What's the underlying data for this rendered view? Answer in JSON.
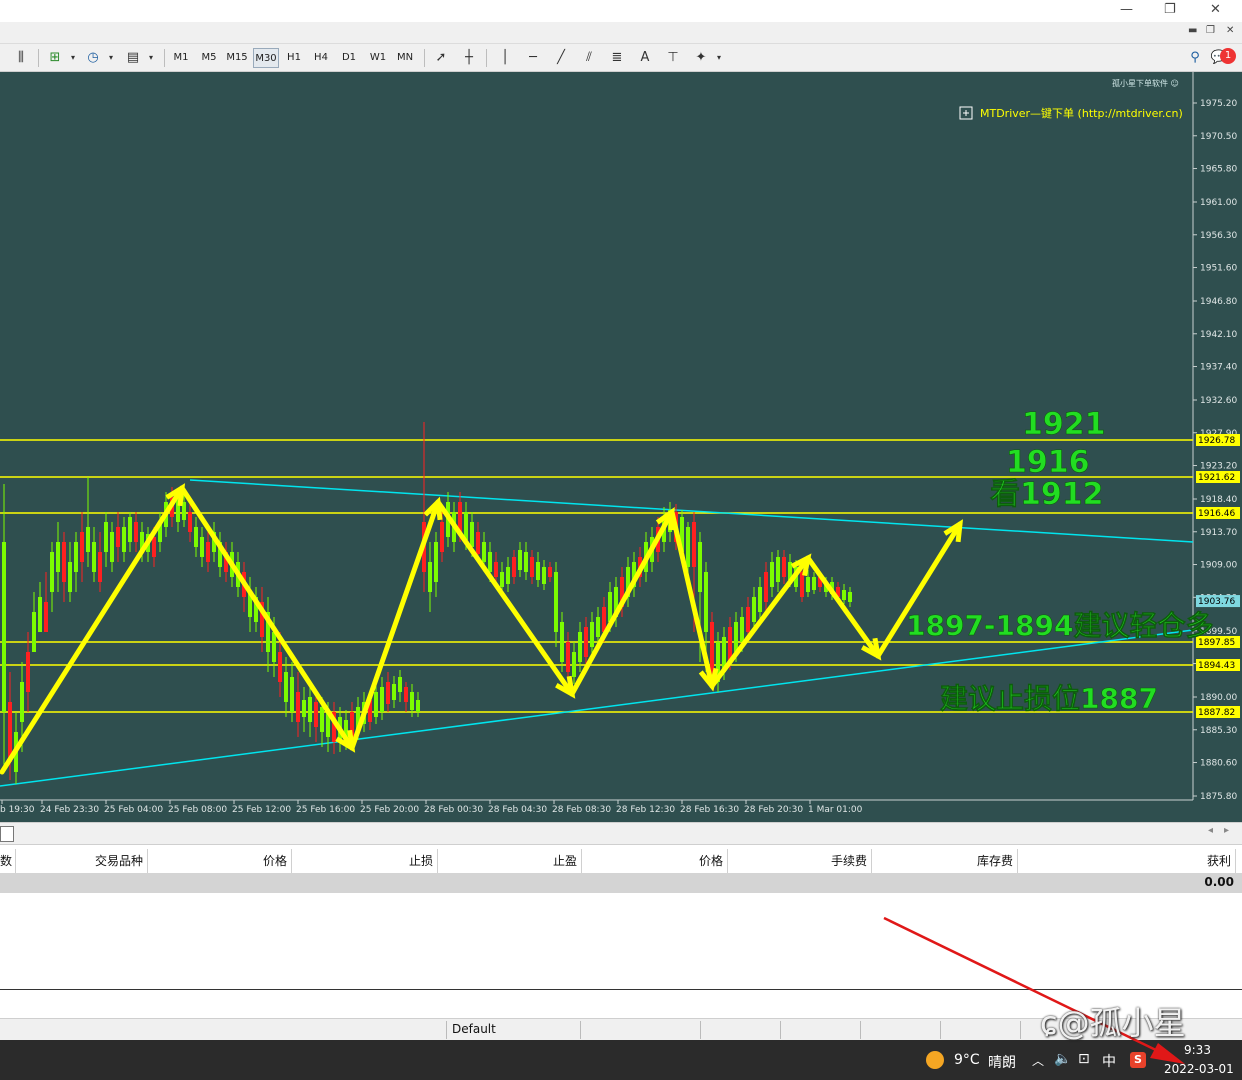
{
  "window": {
    "controls": [
      "—",
      "❐",
      "✕"
    ],
    "mdi_controls": [
      "▬",
      "❐",
      "✕"
    ]
  },
  "toolbar": {
    "timeframes": [
      "M1",
      "M5",
      "M15",
      "M30",
      "H1",
      "H4",
      "D1",
      "W1",
      "MN"
    ],
    "active_timeframe": "M30",
    "notifications_badge": "1"
  },
  "chart": {
    "corner_label": "孤小星下单软件 ☺",
    "plugin_label": "MTDriver—键下单 (http://mtdriver.cn)",
    "price_labels": [
      "1975.20",
      "1970.50",
      "1965.80",
      "1961.00",
      "1956.30",
      "1951.60",
      "1946.80",
      "1942.10",
      "1937.40",
      "1932.60",
      "1927.90",
      "1923.20",
      "1918.40",
      "1913.70",
      "1909.00",
      "1904.30",
      "1899.50",
      "1894.80",
      "1890.00",
      "1885.30",
      "1880.60",
      "1875.80"
    ],
    "level_tags": [
      {
        "price": "1926.78",
        "color": "#ffff00"
      },
      {
        "price": "1921.62",
        "color": "#ffff00"
      },
      {
        "price": "1916.46",
        "color": "#ffff00"
      },
      {
        "price": "1903.76",
        "color": "#7fd8e0"
      },
      {
        "price": "1897.85",
        "color": "#ffff00"
      },
      {
        "price": "1894.43",
        "color": "#ffff00"
      },
      {
        "price": "1887.82",
        "color": "#ffff00"
      }
    ],
    "time_labels": [
      "b 19:30",
      "24 Feb 23:30",
      "25 Feb 04:00",
      "25 Feb 08:00",
      "25 Feb 12:00",
      "25 Feb 16:00",
      "25 Feb 20:00",
      "28 Feb 00:30",
      "28 Feb 04:30",
      "28 Feb 08:30",
      "28 Feb 12:30",
      "28 Feb 16:30",
      "28 Feb 20:30",
      "1 Mar 01:00"
    ],
    "annotations": {
      "a1921": "1921",
      "a1916": "1916",
      "a1912": "看1912",
      "buy_zone": "1897-1894建议轻仓多",
      "stop_loss": "建议止损位1887"
    },
    "colors": {
      "background": "#2f4f4f",
      "levels": "#ffff00",
      "trendline": "#00e5ee",
      "bull": "#7cfc00",
      "bear": "#ff2020",
      "annotation": "#22dd22"
    }
  },
  "terminal": {
    "columns": [
      "数",
      "交易品种",
      "价格",
      "止损",
      "止盈",
      "价格",
      "手续费",
      "库存费",
      "获利"
    ],
    "total": "0.00"
  },
  "statusbar": {
    "profile": "Default"
  },
  "taskbar": {
    "weather_temp": "9°C",
    "weather_text": "晴朗",
    "ime": "中",
    "time": "9:33",
    "date": "2022-03-01"
  },
  "watermark": "ɕ@孤小星"
}
